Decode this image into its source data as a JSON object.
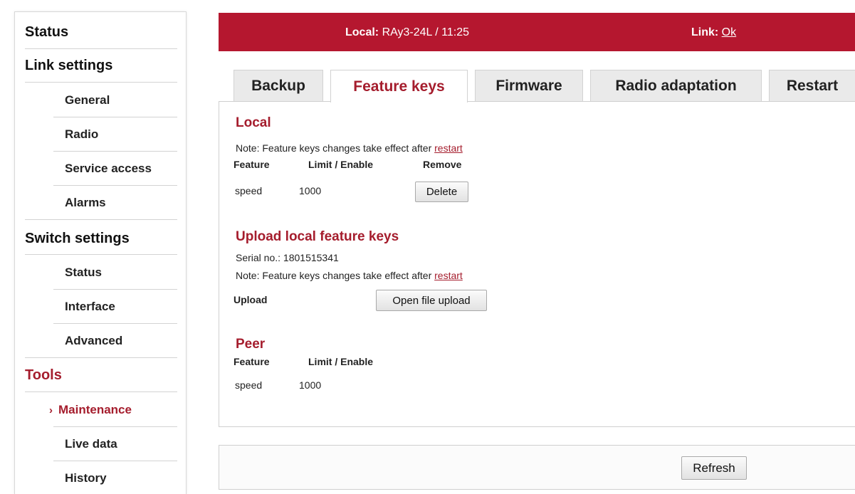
{
  "sidebar": {
    "status": "Status",
    "link_settings": "Link settings",
    "general": "General",
    "radio": "Radio",
    "service_access": "Service access",
    "alarms": "Alarms",
    "switch_settings": "Switch settings",
    "switch_status": "Status",
    "interface": "Interface",
    "advanced": "Advanced",
    "tools": "Tools",
    "maintenance_arrow": "›",
    "maintenance": "Maintenance",
    "live_data": "Live data",
    "history": "History"
  },
  "header": {
    "local_label": "Local:",
    "local_value": "RAy3-24L / 11:25",
    "link_label": "Link:",
    "link_value": "Ok",
    "bg_color": "#b5172f"
  },
  "tabs": [
    "Backup",
    "Feature keys",
    "Firmware",
    "Radio adaptation",
    "Restart"
  ],
  "active_tab": "Feature keys",
  "local": {
    "title": "Local",
    "note_text": "Note: Feature keys changes take effect after ",
    "note_link": "restart",
    "col_feature": "Feature",
    "col_limit": "Limit / Enable",
    "col_remove": "Remove",
    "row_feature": "speed",
    "row_limit": "1000",
    "delete_label": "Delete"
  },
  "upload": {
    "title": "Upload local feature keys",
    "serial": "Serial no.: 1801515341",
    "note_text": "Note: Feature keys changes take effect after ",
    "note_link": "restart",
    "label": "Upload",
    "button": "Open file upload"
  },
  "peer": {
    "title": "Peer",
    "col_feature": "Feature",
    "col_limit": "Limit / Enable",
    "row_feature": "speed",
    "row_limit": "1000"
  },
  "footer": {
    "refresh_label": "Refresh"
  },
  "colors": {
    "accent": "#a51d2d",
    "header": "#b5172f"
  }
}
